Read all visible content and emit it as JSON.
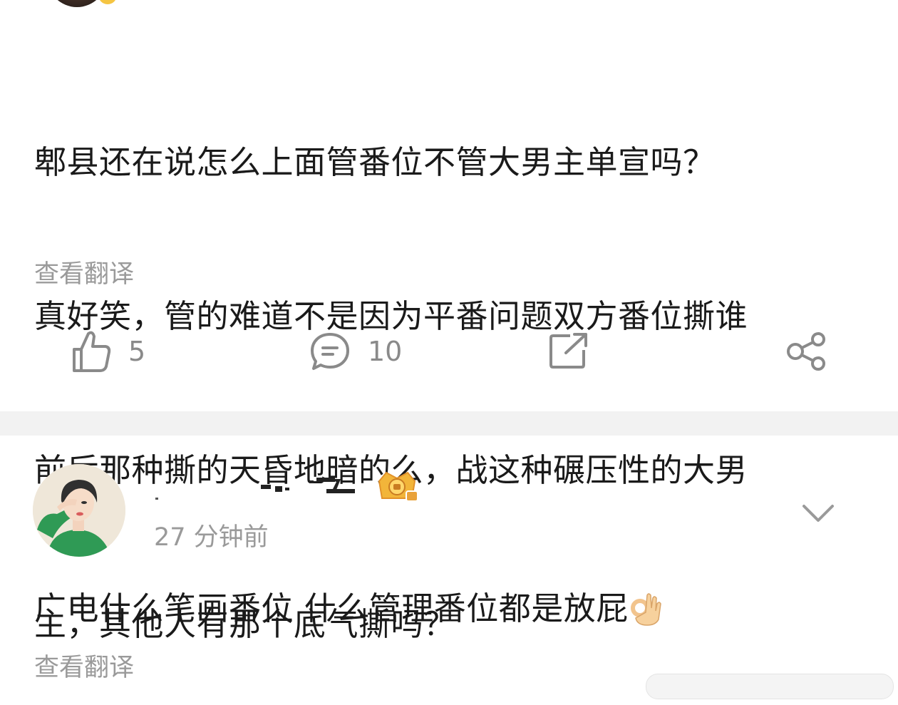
{
  "post": {
    "text_lines": [
      "郫县还在说怎么上面管番位不管大男主单宣吗？",
      "真好笑，管的难道不是因为平番问题双方番位撕谁",
      "前后那种撕的天昏地暗的么，战这种碾压性的大男",
      "主，其他人有那个底气撕吗？"
    ],
    "translate_label": "查看翻译",
    "actions": {
      "like_icon": "thumbs-up-icon",
      "like_count": "5",
      "comment_icon": "comment-bubble-icon",
      "comment_count": "10",
      "repost_icon": "repost-icon",
      "share_icon": "share-icon"
    }
  },
  "comment": {
    "timestamp": "27 分钟前",
    "text": "广电什么笔画番位 什么管理番位都是放屁",
    "emoji": "ok-hand-emoji",
    "translate_label": "查看翻译",
    "more_icon": "chevron-down-icon",
    "badge_icon": "vip-crown-badge-icon"
  },
  "colors": {
    "text_primary": "#1a1a1a",
    "text_secondary": "#9a9a9a",
    "icon_gray": "#8a8a8a",
    "divider": "#f2f2f2"
  }
}
